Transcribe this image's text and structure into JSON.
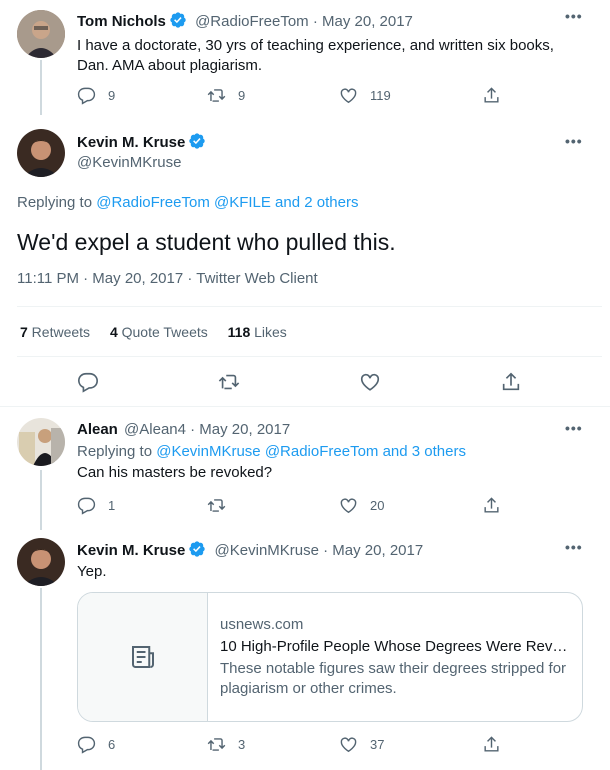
{
  "colors": {
    "accent": "#1d9bf0",
    "text": "#0f1419",
    "secondary": "#536471",
    "border": "#cfd9de"
  },
  "tweet1": {
    "name": "Tom Nichols",
    "handle_date": "@RadioFreeTom · May 20, 2017",
    "text": "I have a doctorate, 30 yrs of teaching experience, and written six books, Dan. AMA about plagiarism.",
    "replies": "9",
    "retweets": "9",
    "likes": "119"
  },
  "main": {
    "name": "Kevin M. Kruse",
    "handle": "@KevinMKruse",
    "replying_prefix": "Replying to ",
    "replying_mentions": "@RadioFreeTom @KFILE and 2 others",
    "text": "We'd expel a student who pulled this.",
    "timestamp": "11:11 PM · May 20, 2017 · Twitter Web Client",
    "stats": {
      "retweets_num": "7",
      "retweets_label": " Retweets",
      "quotes_num": "4",
      "quotes_label": " Quote Tweets",
      "likes_num": "118",
      "likes_label": " Likes"
    }
  },
  "reply1": {
    "name": "Alean",
    "handle_date": "@Alean4 · May 20, 2017",
    "replying_prefix": "Replying to ",
    "replying_mentions": "@KevinMKruse @RadioFreeTom and 3 others",
    "text": "Can his masters be revoked?",
    "replies": "1",
    "retweets": "",
    "likes": "20"
  },
  "reply2": {
    "name": "Kevin M. Kruse",
    "handle_date": "@KevinMKruse · May 20, 2017",
    "text": "Yep.",
    "card": {
      "domain": "usnews.com",
      "title": "10 High-Profile People Whose Degrees Were Revo...",
      "description": "These notable figures saw their degrees stripped for plagiarism or other crimes."
    },
    "replies": "6",
    "retweets": "3",
    "likes": "37"
  },
  "icons": [
    "verified-icon",
    "more-icon",
    "reply-icon",
    "retweet-icon",
    "like-icon",
    "share-icon",
    "article-icon"
  ]
}
